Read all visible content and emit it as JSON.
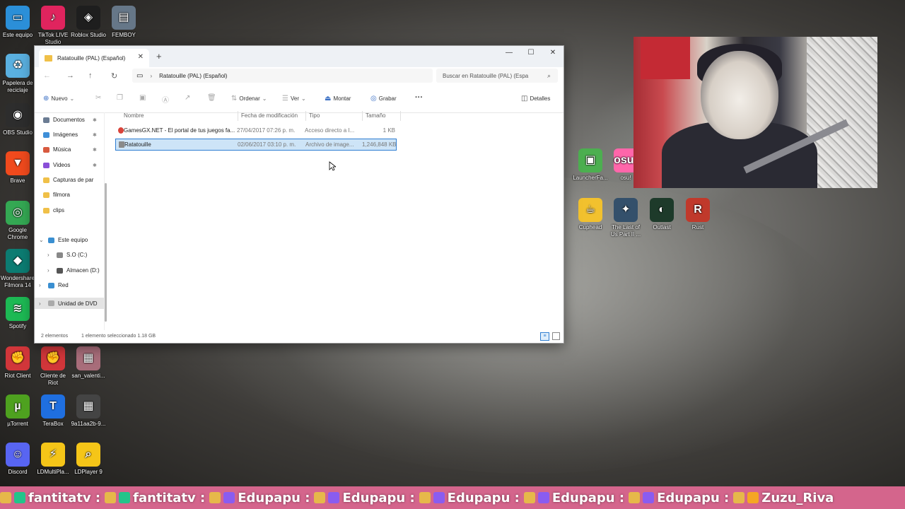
{
  "desktop": {
    "left_icons": [
      {
        "label": "Este equipo",
        "color": "#2b8fd8",
        "glyph": "▭"
      },
      {
        "label": "Papelera de reciclaje",
        "color": "#5ab0e0",
        "glyph": "♻"
      },
      {
        "label": "OBS Studio",
        "color": "#2d2d2d",
        "glyph": "◉"
      },
      {
        "label": "Brave",
        "color": "#f04a1d",
        "glyph": "▼"
      },
      {
        "label": "Google Chrome",
        "color": "#34a853",
        "glyph": "◎"
      },
      {
        "label": "Wondershare Filmora 14",
        "color": "#0c7c72",
        "glyph": "◆"
      },
      {
        "label": "Spotify",
        "color": "#1db954",
        "glyph": "≋"
      },
      {
        "label": "Riot Client",
        "color": "#d1363a",
        "glyph": "✊"
      },
      {
        "label": "µTorrent",
        "color": "#4ea11f",
        "glyph": "µ"
      },
      {
        "label": "Discord",
        "color": "#5865f2",
        "glyph": "☺"
      }
    ],
    "top_icons": [
      {
        "label": "TikTok LIVE Studio",
        "color": "#e0245e",
        "glyph": "♪"
      },
      {
        "label": "Roblox Studio",
        "color": "#1e1e1e",
        "glyph": "◈"
      },
      {
        "label": "FEMBOY",
        "color": "#667788",
        "glyph": "▤"
      }
    ],
    "col2_icons": [
      {
        "label": "Cliente de Riot",
        "color": "#d1363a",
        "glyph": "✊"
      },
      {
        "label": "TeraBox",
        "color": "#1f6fe0",
        "glyph": "T"
      },
      {
        "label": "LDMultiPla...",
        "color": "#f5c518",
        "glyph": "⚡"
      }
    ],
    "col3_icons": [
      {
        "label": "san_valenti...",
        "color": "#a86d7a",
        "glyph": "▦"
      },
      {
        "label": "9a11aa2b-9...",
        "color": "#444",
        "glyph": "▦"
      },
      {
        "label": "LDPlayer 9",
        "color": "#f5c518",
        "glyph": "⌕"
      }
    ],
    "right_icons": [
      {
        "label": "LauncherFa...",
        "color": "#4caf50",
        "glyph": "▣"
      },
      {
        "label": "osu!",
        "color": "#ff66aa",
        "glyph": "osu!"
      },
      {
        "label": "Cuphead",
        "color": "#f2c12e",
        "glyph": "☕"
      },
      {
        "label": "The Last of Us Part II ...",
        "color": "#34506b",
        "glyph": "✦"
      },
      {
        "label": "Outlast",
        "color": "#1d3a2a",
        "glyph": "◐"
      },
      {
        "label": "Rust",
        "color": "#c0392b",
        "glyph": "R"
      }
    ]
  },
  "explorer": {
    "tab_title": "Ratatouille (PAL) (Español)",
    "path": "Ratatouille (PAL) (Español)",
    "search_placeholder": "Buscar en Ratatouille (PAL) (Espa",
    "toolbar": {
      "new": "Nuevo",
      "sort": "Ordenar",
      "view": "Ver",
      "mount": "Montar",
      "burn": "Grabar",
      "more": "···",
      "details": "Detalles"
    },
    "nav": [
      {
        "label": "Documentos",
        "color": "#6b7c93",
        "pinned": true
      },
      {
        "label": "Imágenes",
        "color": "#3f8fd8",
        "pinned": true
      },
      {
        "label": "Música",
        "color": "#d85a3f",
        "pinned": true
      },
      {
        "label": "Videos",
        "color": "#8a4fd8",
        "pinned": true
      },
      {
        "label": "Capturas de par",
        "color": "#f0c048",
        "pinned": false
      },
      {
        "label": "filmora",
        "color": "#f0c048",
        "pinned": false
      },
      {
        "label": "clips",
        "color": "#f0c048",
        "pinned": false
      },
      {
        "label": "Este equipo",
        "color": "#3a8fd1",
        "pinned": false
      },
      {
        "label": "S.O (C:)",
        "color": "#888",
        "pinned": false
      },
      {
        "label": "Almacen (D:)",
        "color": "#555",
        "pinned": false
      },
      {
        "label": "Red",
        "color": "#3a8fd1",
        "pinned": false
      },
      {
        "label": "Unidad de DVD",
        "color": "#aaa",
        "pinned": false
      }
    ],
    "columns": {
      "name": "Nombre",
      "date": "Fecha de modificación",
      "type": "Tipo",
      "size": "Tamaño"
    },
    "files": [
      {
        "name": "GamesGX.NET - El portal de tus juegos fa...",
        "date": "27/04/2017 07:26 p. m.",
        "type": "Acceso directo a I...",
        "size": "1 KB",
        "selected": false,
        "icon_color": "#d9433a"
      },
      {
        "name": "Ratatouille",
        "date": "02/06/2017 03:10 p. m.",
        "type": "Archivo de image...",
        "size": "1,246,848 KB",
        "selected": true,
        "icon_color": "#8a8a8a"
      }
    ],
    "status": {
      "count": "2 elementos",
      "selection": "1 elemento seleccionado  1.18 GB"
    }
  },
  "ticker": [
    {
      "user": "fantitatv :",
      "color": "#23c48a"
    },
    {
      "user": "fantitatv :",
      "color": "#23c48a"
    },
    {
      "user": "Edupapu :",
      "color": "#8a5cf0"
    },
    {
      "user": "Edupapu :",
      "color": "#8a5cf0"
    },
    {
      "user": "Edupapu :",
      "color": "#8a5cf0"
    },
    {
      "user": "Edupapu :",
      "color": "#8a5cf0"
    },
    {
      "user": "Edupapu :",
      "color": "#8a5cf0"
    },
    {
      "user": "Zuzu_Riva",
      "color": "#f5a623"
    }
  ]
}
